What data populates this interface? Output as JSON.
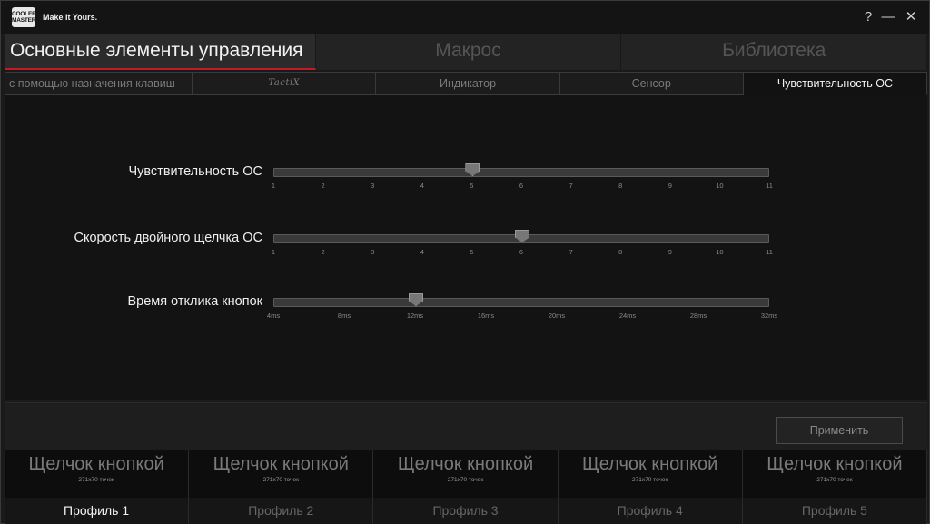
{
  "app": {
    "logo_text": "COOLER MASTER",
    "tagline": "Make It Yours."
  },
  "window_controls": {
    "help": "?",
    "minimize": "—",
    "close": "✕"
  },
  "main_tabs": [
    {
      "label": "Основные элементы управления"
    },
    {
      "label": "Макрос"
    },
    {
      "label": "Библиотека"
    }
  ],
  "sub_tabs": [
    {
      "label": "с помощью назначения клавиш"
    },
    {
      "label": "TactiX"
    },
    {
      "label": "Индикатор"
    },
    {
      "label": "Сенсор"
    },
    {
      "label": "Чувствительность ОС"
    }
  ],
  "settings": [
    {
      "label": "Чувствительность ОС",
      "ticks": [
        "1",
        "2",
        "3",
        "4",
        "5",
        "6",
        "7",
        "8",
        "9",
        "10",
        "11"
      ],
      "value_index": 4
    },
    {
      "label": "Скорость двойного щелчка ОС",
      "ticks": [
        "1",
        "2",
        "3",
        "4",
        "5",
        "6",
        "7",
        "8",
        "9",
        "10",
        "11"
      ],
      "value_index": 5
    },
    {
      "label": "Время отклика кнопок",
      "ticks": [
        "4ms",
        "8ms",
        "12ms",
        "16ms",
        "20ms",
        "24ms",
        "28ms",
        "32ms"
      ],
      "value_index": 2
    }
  ],
  "apply_label": "Применить",
  "profiles": [
    {
      "title": "Щелчок кнопкой",
      "size": "271x70 точек",
      "name": "Профиль 1"
    },
    {
      "title": "Щелчок кнопкой",
      "size": "271x70 точек",
      "name": "Профиль 2"
    },
    {
      "title": "Щелчок кнопкой",
      "size": "271x70 точек",
      "name": "Профиль 3"
    },
    {
      "title": "Щелчок кнопкой",
      "size": "271x70 точек",
      "name": "Профиль 4"
    },
    {
      "title": "Щелчок кнопкой",
      "size": "271x70 точек",
      "name": "Профиль 5"
    }
  ],
  "colors": {
    "accent": "#c21a22"
  }
}
